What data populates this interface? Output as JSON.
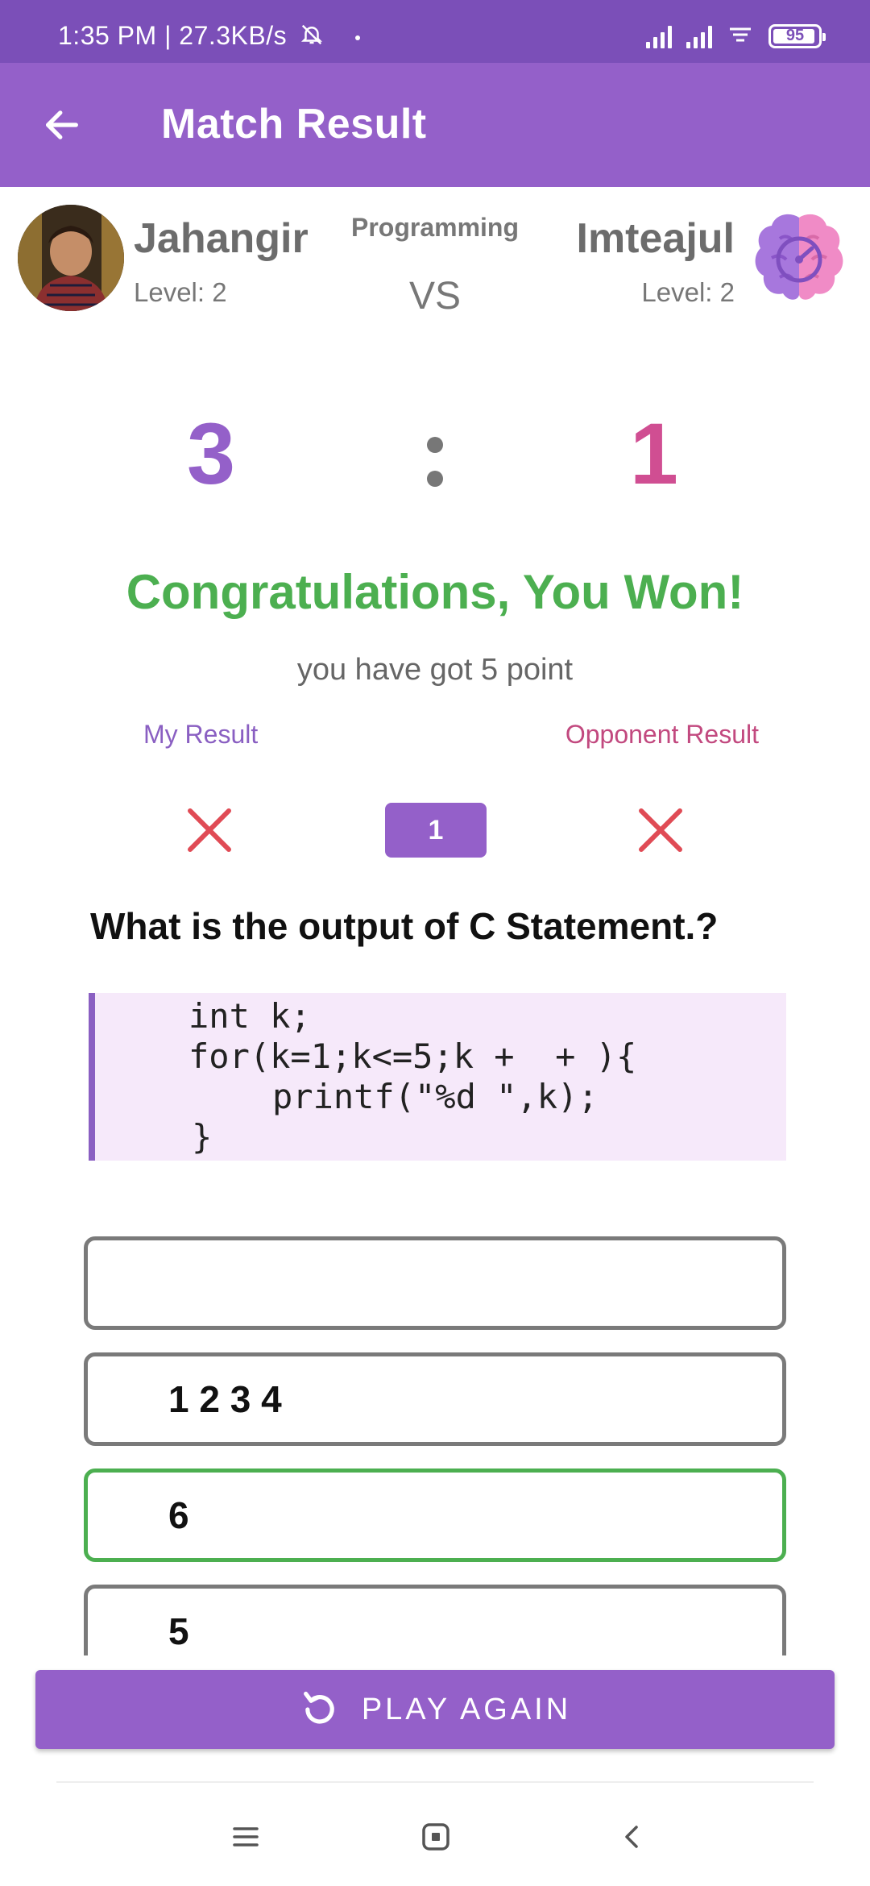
{
  "status_bar": {
    "time_speed": "1:35 PM | 27.3KB/s",
    "battery": "95"
  },
  "app_bar": {
    "title": "Match Result"
  },
  "match": {
    "category": "Programming",
    "vs": "VS",
    "player": {
      "name": "Jahangir",
      "level": "Level: 2",
      "score": "3"
    },
    "opponent": {
      "name": "Imteajul",
      "level": "Level: 2",
      "score": "1"
    }
  },
  "result": {
    "headline": "Congratulations, You Won!",
    "points": "you have got 5 point",
    "my_result_label": "My Result",
    "opponent_result_label": "Opponent Result",
    "question_number": "1"
  },
  "question": {
    "text": "What is the output of C Statement.?",
    "code": [
      "int k;",
      "for(k=1;k<=5;k +  + ){",
      "printf(\"%d \",k);",
      "}"
    ]
  },
  "options": [
    {
      "label": "",
      "state": "normal"
    },
    {
      "label": "1 2 3 4",
      "state": "normal"
    },
    {
      "label": "6",
      "state": "correct"
    },
    {
      "label": "5",
      "state": "normal"
    }
  ],
  "actions": {
    "play_again": "PLAY AGAIN"
  },
  "colors": {
    "status_bar": "#7b4fb8",
    "primary": "#9460c9",
    "opponent_accent": "#d04e92",
    "success": "#4caf50",
    "wrong_mark": "#e04b55",
    "code_bg": "#f6e9fa"
  },
  "icons": {
    "back": "arrow-left-icon",
    "wrong": "cross-icon",
    "replay": "replay-icon",
    "opponent_avatar": "brain-icon"
  }
}
